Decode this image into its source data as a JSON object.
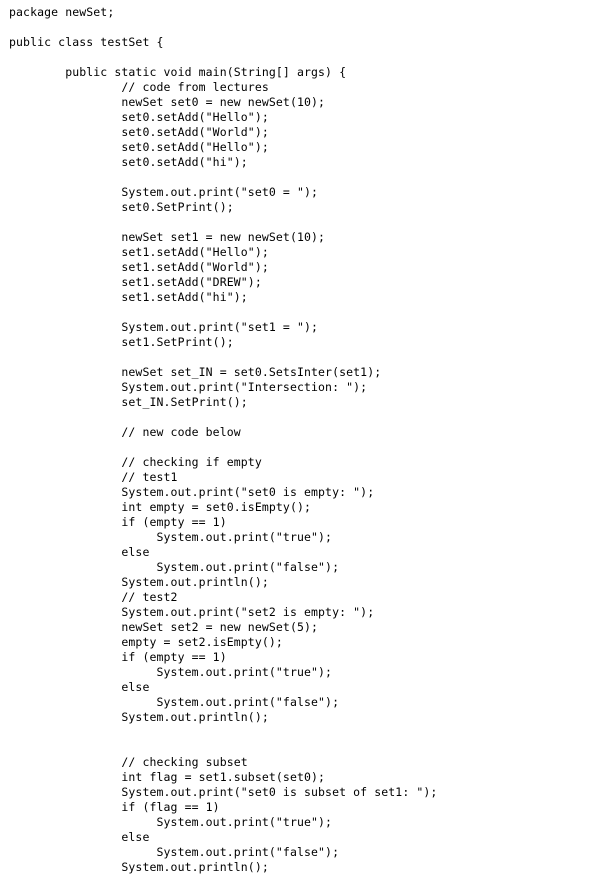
{
  "document": {
    "kind": "source-code-listing",
    "language": "Java",
    "package": "newSet",
    "class": "testSet",
    "background_color": "#ffffff",
    "text_color": "#000000",
    "indent_unit_spaces": 8,
    "lines": [
      "package newSet;",
      "",
      "public class testSet {",
      "",
      "        public static void main(String[] args) {",
      "                // code from lectures",
      "                newSet set0 = new newSet(10);",
      "                set0.setAdd(\"Hello\");",
      "                set0.setAdd(\"World\");",
      "                set0.setAdd(\"Hello\");",
      "                set0.setAdd(\"hi\");",
      "",
      "                System.out.print(\"set0 = \");",
      "                set0.SetPrint();",
      "",
      "                newSet set1 = new newSet(10);",
      "                set1.setAdd(\"Hello\");",
      "                set1.setAdd(\"World\");",
      "                set1.setAdd(\"DREW\");",
      "                set1.setAdd(\"hi\");",
      "",
      "                System.out.print(\"set1 = \");",
      "                set1.SetPrint();",
      "",
      "                newSet set_IN = set0.SetsInter(set1);",
      "                System.out.print(\"Intersection: \");",
      "                set_IN.SetPrint();",
      "",
      "                // new code below",
      "",
      "                // checking if empty",
      "                // test1",
      "                System.out.print(\"set0 is empty: \");",
      "                int empty = set0.isEmpty();",
      "                if (empty == 1)",
      "                     System.out.print(\"true\");",
      "                else",
      "                     System.out.print(\"false\");",
      "                System.out.println();",
      "                // test2",
      "                System.out.print(\"set2 is empty: \");",
      "                newSet set2 = new newSet(5);",
      "                empty = set2.isEmpty();",
      "                if (empty == 1)",
      "                     System.out.print(\"true\");",
      "                else",
      "                     System.out.print(\"false\");",
      "                System.out.println();",
      "",
      "",
      "                // checking subset",
      "                int flag = set1.subset(set0);",
      "                System.out.print(\"set0 is subset of set1: \");",
      "                if (flag == 1)",
      "                     System.out.print(\"true\");",
      "                else",
      "                     System.out.print(\"false\");",
      "                System.out.println();"
    ]
  }
}
